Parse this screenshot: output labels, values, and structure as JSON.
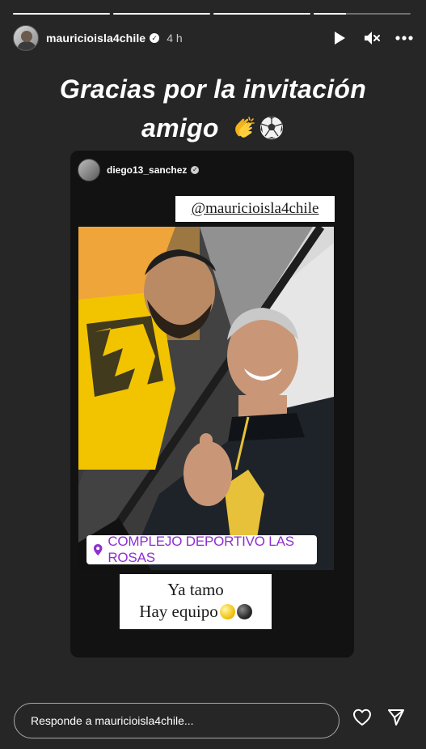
{
  "story": {
    "segments": [
      {
        "fill": 1.0
      },
      {
        "fill": 1.0
      },
      {
        "fill": 1.0
      },
      {
        "fill": 0.33
      }
    ],
    "author": "mauricioisla4chile",
    "time": "4 h",
    "headline_line1": "Gracias por la invitación",
    "headline_line2": "amigo",
    "headline_emojis": [
      "clapping-hands",
      "soccer-ball"
    ]
  },
  "reshare": {
    "author": "diego13_sanchez",
    "mention_sticker": "@mauricioisla4chile",
    "location_sticker": "COMPLEJO DEPORTIVO LAS ROSAS",
    "caption_line1": "Ya tamo",
    "caption_line2": "Hay equipo"
  },
  "reply": {
    "placeholder": "Responde a mauricioisla4chile..."
  },
  "icons": {
    "play": "play-icon",
    "mute": "mute-icon",
    "more": "more-icon",
    "like": "heart-icon",
    "share": "send-icon",
    "location": "location-pin-icon"
  },
  "colors": {
    "background": "#262626",
    "card": "#121212",
    "location_text": "#8e2fd0"
  }
}
